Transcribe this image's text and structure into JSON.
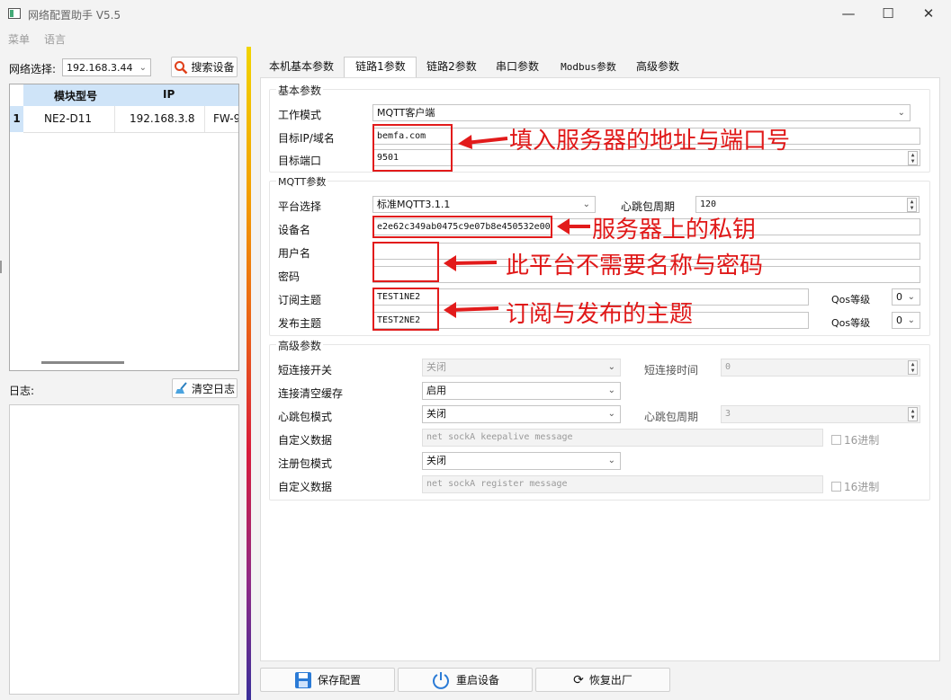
{
  "window": {
    "title": "网络配置助手 V5.5",
    "minimize": "—",
    "maximize": "☐",
    "close": "✕"
  },
  "menu": {
    "items": [
      "菜单",
      "语言"
    ]
  },
  "left": {
    "net_label": "网络选择:",
    "net_value": "192.168.3.44",
    "search_button": "搜索设备",
    "table": {
      "headers": [
        "模块型号",
        "IP"
      ],
      "row": {
        "index": "1",
        "model": "NE2-D11",
        "ip": "192.168.3.8",
        "fw": "FW-9"
      }
    },
    "log_label": "日志:",
    "clear_log_button": "清空日志"
  },
  "tabs": [
    "本机基本参数",
    "链路1参数",
    "链路2参数",
    "串口参数",
    "Modbus参数",
    "高级参数"
  ],
  "basic": {
    "title": "基本参数",
    "mode_label": "工作模式",
    "mode_value": "MQTT客户端",
    "ip_label": "目标IP/域名",
    "ip_value": "bemfa.com",
    "port_label": "目标端口",
    "port_value": "9501"
  },
  "mqtt": {
    "title": "MQTT参数",
    "platform_label": "平台选择",
    "platform_value": "标准MQTT3.1.1",
    "heartbeat_label": "心跳包周期",
    "heartbeat_value": "120",
    "device_label": "设备名",
    "device_value": "e2e62c349ab0475c9e07b8e450532e00",
    "user_label": "用户名",
    "user_value": "",
    "pass_label": "密码",
    "pass_value": "",
    "sub_label": "订阅主题",
    "sub_value": "TEST1NE2",
    "pub_label": "发布主题",
    "pub_value": "TEST2NE2",
    "qos_label": "Qos等级",
    "qos_sub": "0",
    "qos_pub": "0"
  },
  "advanced": {
    "title": "高级参数",
    "short_switch_label": "短连接开关",
    "short_switch_value": "关闭",
    "short_time_label": "短连接时间",
    "short_time_value": "0",
    "clear_cache_label": "连接清空缓存",
    "clear_cache_value": "启用",
    "hb_mode_label": "心跳包模式",
    "hb_mode_value": "关闭",
    "hb_period_label": "心跳包周期",
    "hb_period_value": "3",
    "custom1_label": "自定义数据",
    "custom1_value": "net sockA keepalive message",
    "hex1_label": "16进制",
    "reg_mode_label": "注册包模式",
    "reg_mode_value": "关闭",
    "custom2_label": "自定义数据",
    "custom2_value": "net sockA register message",
    "hex2_label": "16进制"
  },
  "annotations": {
    "server": "填入服务器的地址与端口号",
    "key": "服务器上的私钥",
    "nocred": "此平台不需要名称与密码",
    "topics": "订阅与发布的主题",
    "color": "#e21b1b"
  },
  "bottom": {
    "save": "保存配置",
    "restart": "重启设备",
    "restore": "恢复出厂"
  }
}
